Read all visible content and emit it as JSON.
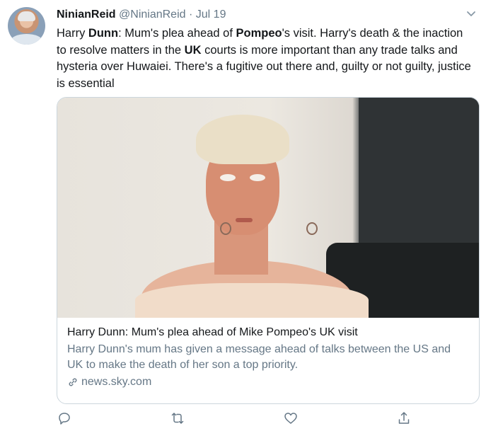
{
  "tweet": {
    "author_name": "NinianReid",
    "author_handle": "@NinianReid",
    "separator": "·",
    "date": "Jul 19",
    "text_parts": [
      {
        "text": "Harry ",
        "bold": false
      },
      {
        "text": "Dunn",
        "bold": true
      },
      {
        "text": ": Mum's plea ahead of ",
        "bold": false
      },
      {
        "text": "Pompeo",
        "bold": true
      },
      {
        "text": "'s visit. Harry's death & the inaction to resolve matters in the ",
        "bold": false
      },
      {
        "text": "UK",
        "bold": true
      },
      {
        "text": " courts is more important than any trade talks and hysteria over Huwaiei. There's a fugitive out there and, guilty or not guilty, justice is essential",
        "bold": false
      }
    ]
  },
  "card": {
    "title": "Harry Dunn: Mum's plea ahead of Mike Pompeo's UK visit",
    "description": "Harry Dunn's mum has given a message ahead of talks between the US and UK to make the death of her son a top priority.",
    "domain": "news.sky.com"
  },
  "icons": {
    "caret": "chevron-down-icon",
    "reply": "reply-icon",
    "retweet": "retweet-icon",
    "like": "heart-icon",
    "share": "share-icon",
    "link": "link-icon"
  },
  "colors": {
    "text_primary": "#14171a",
    "text_secondary": "#657786",
    "border": "#ccd6dd",
    "icon": "#657786"
  }
}
